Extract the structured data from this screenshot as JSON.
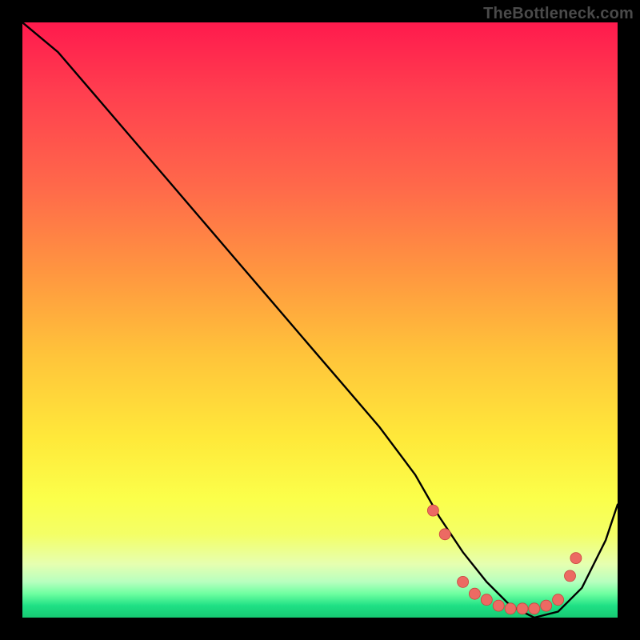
{
  "watermark": "TheBottleneck.com",
  "chart_data": {
    "type": "line",
    "title": "",
    "xlabel": "",
    "ylabel": "",
    "xlim": [
      0,
      100
    ],
    "ylim": [
      0,
      100
    ],
    "background": {
      "gradient_top_color": "#ff1a4d",
      "gradient_bottom_color": "#16c972"
    },
    "series": [
      {
        "name": "bottleneck-curve",
        "color": "#000000",
        "x": [
          0,
          6,
          12,
          18,
          24,
          30,
          36,
          42,
          48,
          54,
          60,
          66,
          70,
          74,
          78,
          82,
          86,
          90,
          94,
          98,
          100
        ],
        "values": [
          100,
          95,
          88,
          81,
          74,
          67,
          60,
          53,
          46,
          39,
          32,
          24,
          17,
          11,
          6,
          2,
          0,
          1,
          5,
          13,
          19
        ]
      }
    ],
    "markers": {
      "name": "highlight-dots",
      "color": "#ec6a63",
      "radius": 7,
      "x": [
        69,
        71,
        74,
        76,
        78,
        80,
        82,
        84,
        86,
        88,
        90,
        92,
        93
      ],
      "values": [
        18,
        14,
        6,
        4,
        3,
        2,
        1.5,
        1.5,
        1.5,
        2,
        3,
        7,
        10
      ]
    }
  }
}
